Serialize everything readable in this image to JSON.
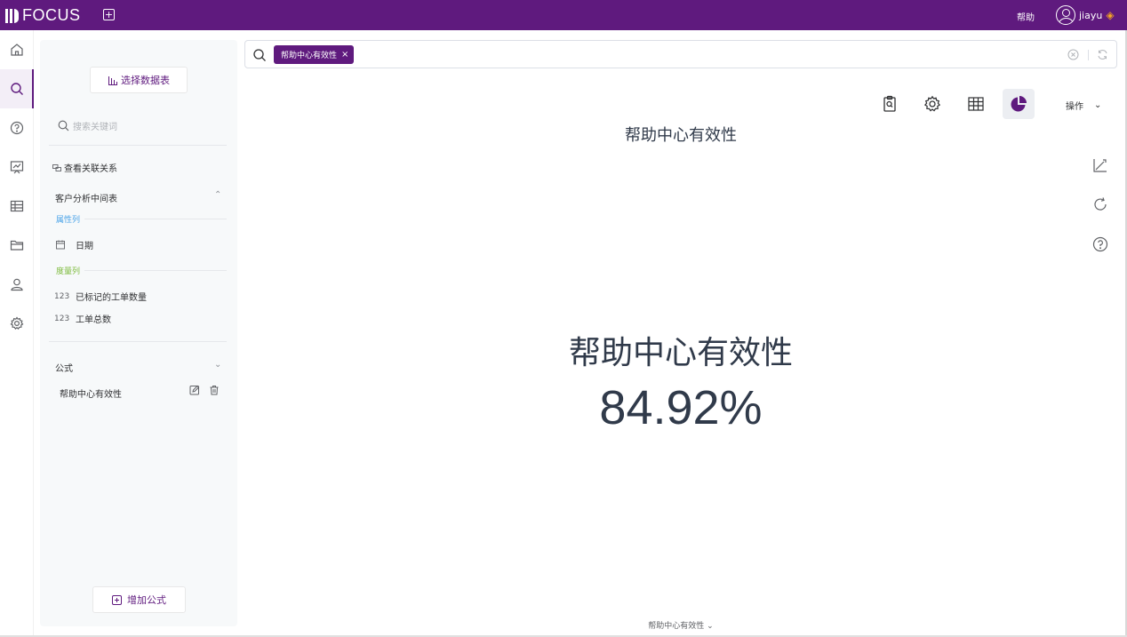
{
  "app": {
    "brand": "FOCUS"
  },
  "topbar": {
    "help_label": "帮助",
    "username": "jiayu"
  },
  "leftnav": {
    "items": [
      {
        "name": "home",
        "icon": "home-icon"
      },
      {
        "name": "search",
        "icon": "search-icon",
        "active": true
      },
      {
        "name": "help",
        "icon": "question-icon"
      },
      {
        "name": "dashboard",
        "icon": "presentation-chart-icon"
      },
      {
        "name": "table",
        "icon": "table-icon"
      },
      {
        "name": "folder",
        "icon": "folder-icon"
      },
      {
        "name": "user",
        "icon": "user-icon"
      },
      {
        "name": "settings",
        "icon": "gear-icon"
      }
    ]
  },
  "sidebar": {
    "select_table_label": "选择数据表",
    "search_placeholder": "搜索关键词",
    "view_relations_label": "查看关联关系",
    "table_name": "客户分析中间表",
    "attr_group_label": "属性列",
    "attr_fields": [
      {
        "type": "date",
        "label": "日期"
      }
    ],
    "measure_group_label": "度量列",
    "measure_fields": [
      {
        "type": "123",
        "label": "已标记的工单数量"
      },
      {
        "type": "123",
        "label": "工单总数"
      }
    ],
    "formula_title": "公式",
    "formulas": [
      {
        "label": "帮助中心有效性"
      }
    ],
    "add_formula_label": "增加公式"
  },
  "searchbar": {
    "tag_label": "帮助中心有效性"
  },
  "toolbar": {
    "ops_label": "操作"
  },
  "chart": {
    "title": "帮助中心有效性",
    "kpi_label": "帮助中心有效性",
    "kpi_value": "84.92%",
    "footer_label": "帮助中心有效性"
  },
  "colors": {
    "brand": "#5f1a7e",
    "attr_group": "#4aa3e8",
    "measure_group": "#7dbb3c",
    "premium": "#f5a623"
  }
}
